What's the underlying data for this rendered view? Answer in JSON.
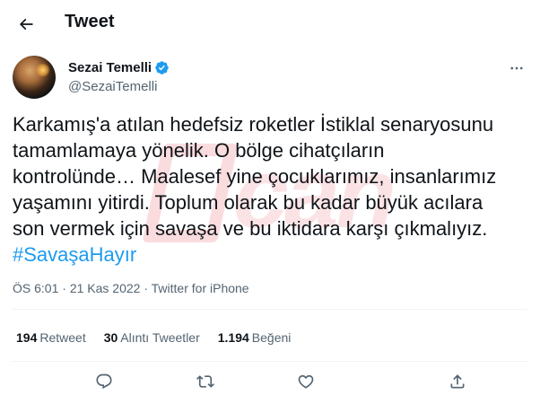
{
  "header": {
    "title": "Tweet",
    "back_icon": "arrow-left-icon"
  },
  "author": {
    "name": "Sezai Temelli",
    "handle": "@SezaiTemelli",
    "verified_icon": "verified-badge-icon",
    "verified_color": "#1d9bf0"
  },
  "tweet": {
    "line1": "Karkamış'a atılan hedefsiz roketler İstiklal senaryosunu",
    "line2": "tamamlamaya yönelik. O bölge cihatçıların",
    "line3": "kontrolünde… Maalesef yine çocuklarımız, insanlarımız",
    "line4": "yaşamını yitirdi. Toplum olarak bu kadar büyük acılara",
    "line5": "son vermek için savaşa ve bu iktidara karşı çıkmalıyız.",
    "hashtag": "#SavaşaHayır"
  },
  "meta": {
    "time": "ÖS 6:01",
    "separator1": "·",
    "date": "21 Kas 2022",
    "separator2": "·",
    "source": "Twitter for iPhone"
  },
  "stats": {
    "retweets_count": "194",
    "retweets_label": "Retweet",
    "quotes_count": "30",
    "quotes_label": "Alıntı Tweetler",
    "likes_count": "1.194",
    "likes_label": "Beğeni"
  },
  "actions": [
    "reply-icon",
    "retweet-icon",
    "like-icon",
    "share-icon"
  ],
  "colors": {
    "text": "#0f1419",
    "secondary": "#536471",
    "accent": "#1d9bf0",
    "watermark": "#e23c46"
  }
}
